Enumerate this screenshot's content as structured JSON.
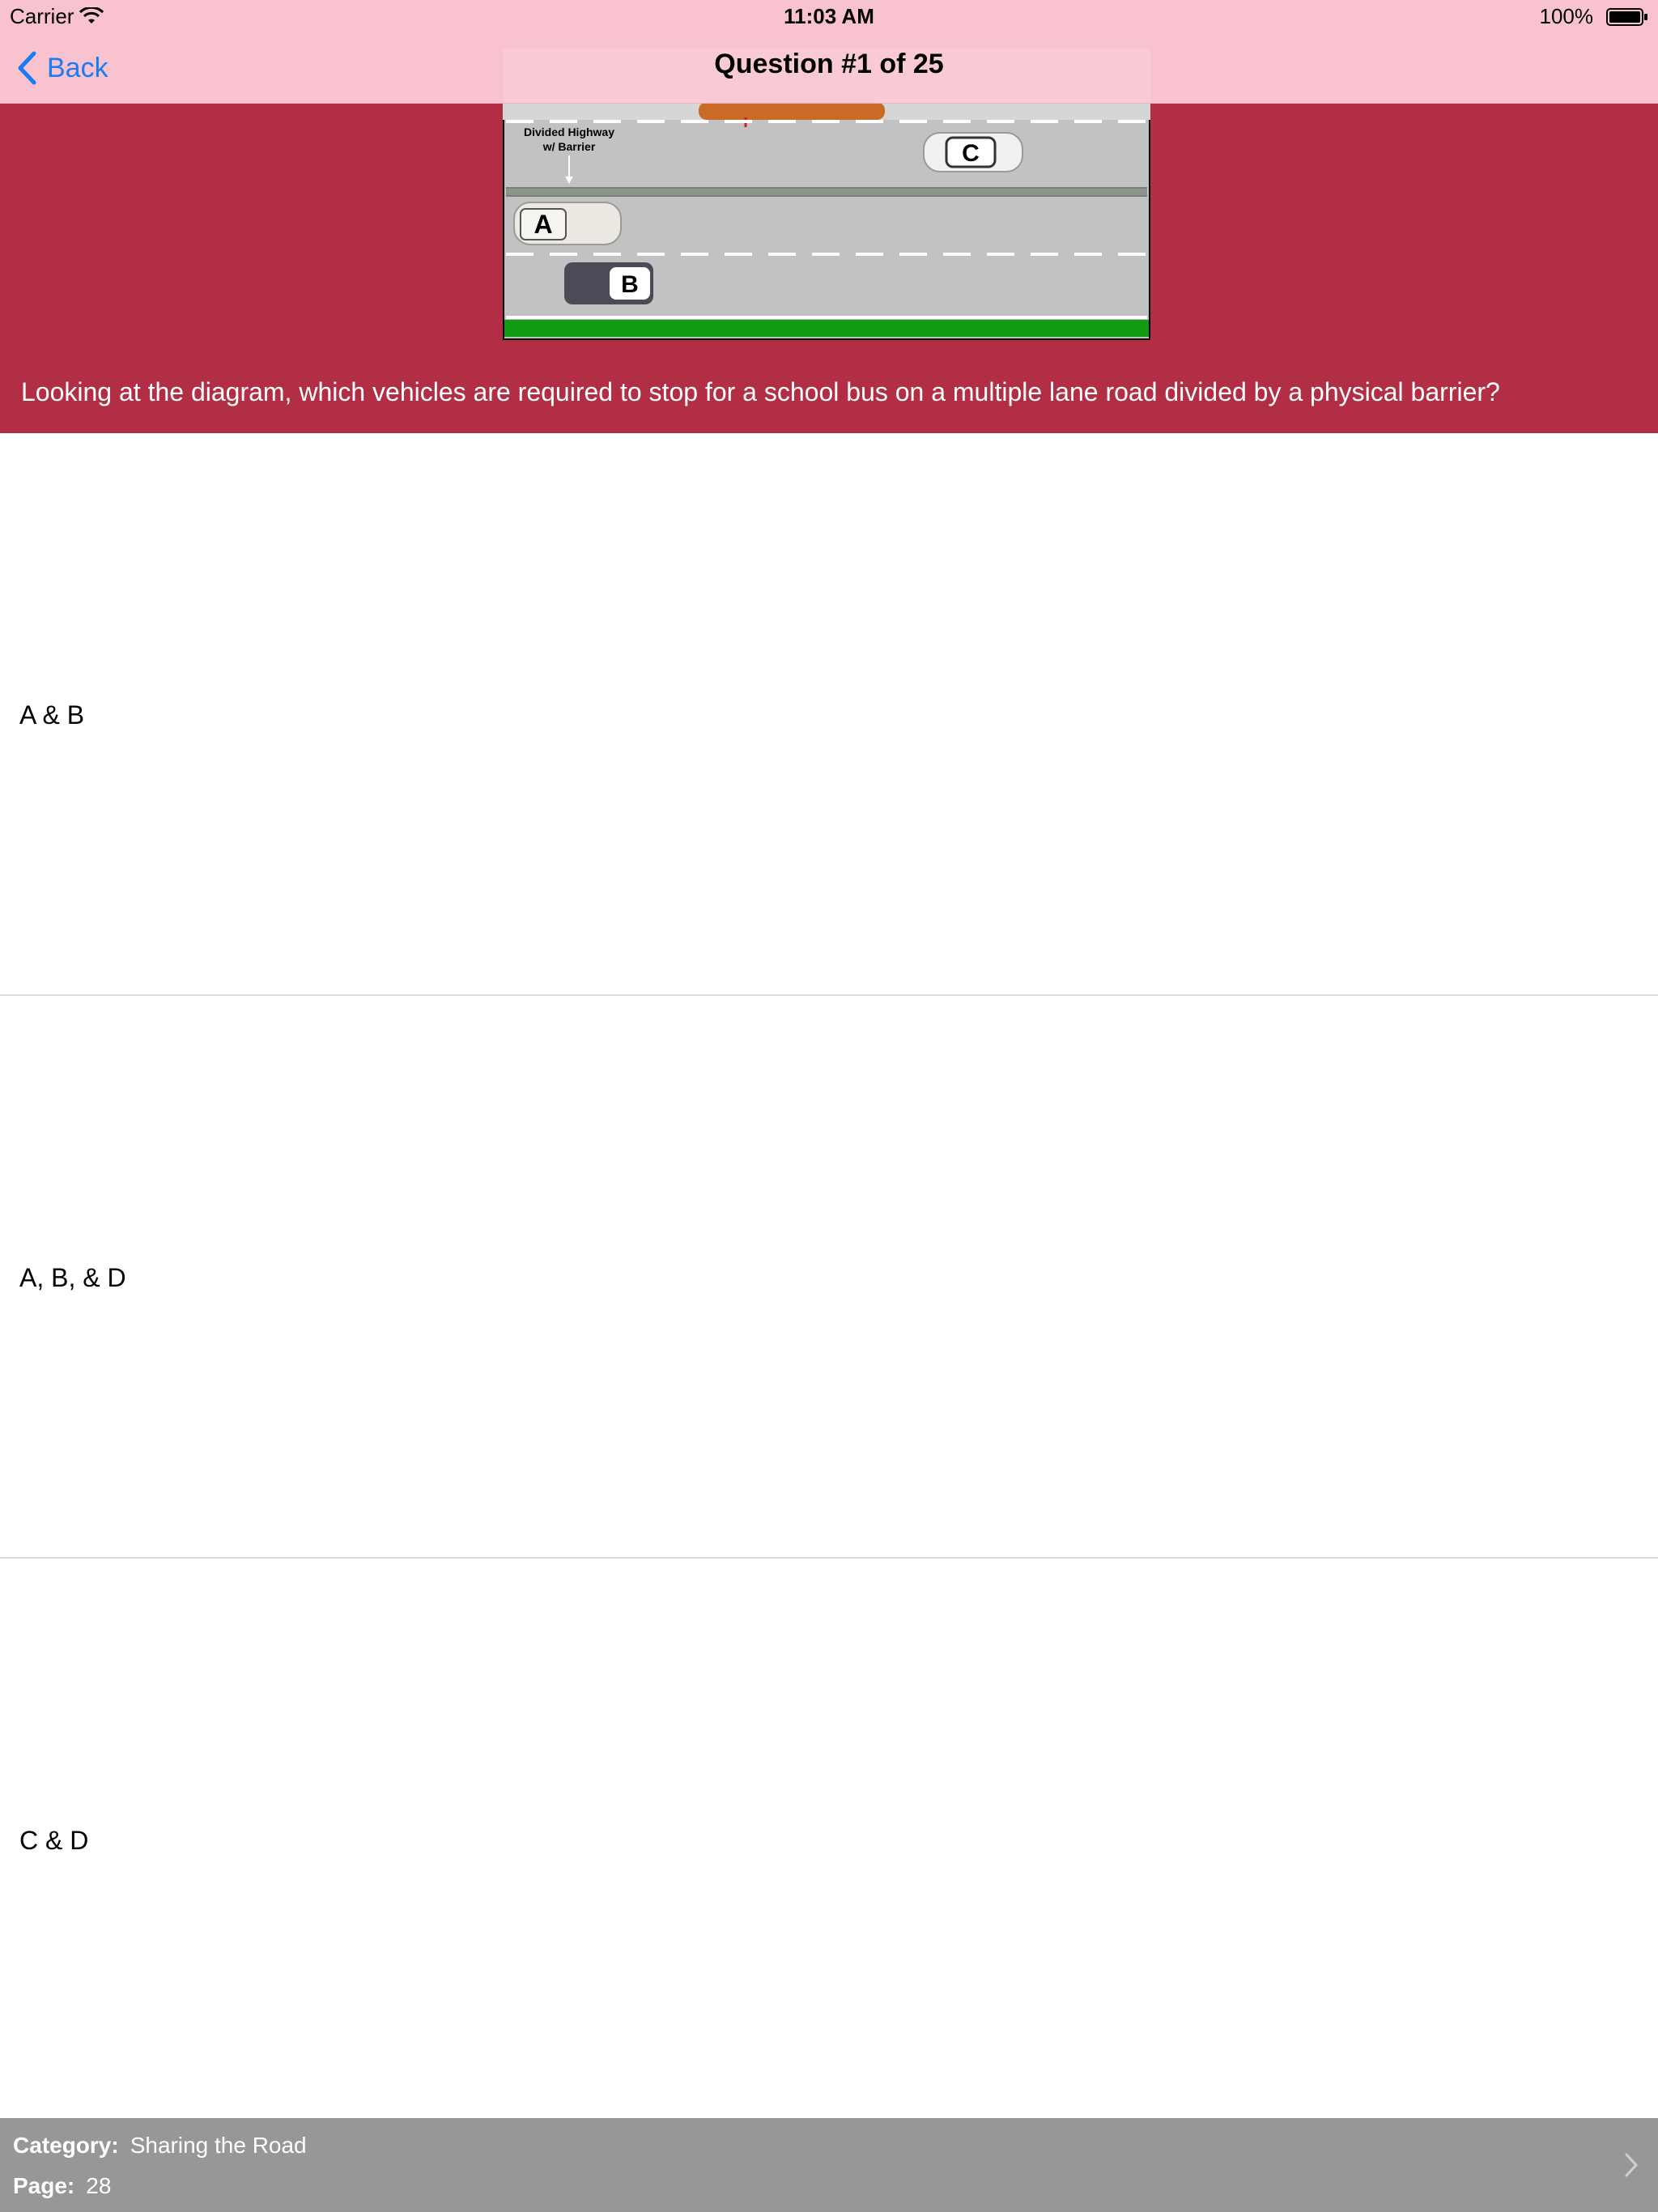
{
  "status_bar": {
    "carrier": "Carrier",
    "time": "11:03 AM",
    "battery": "100%"
  },
  "nav": {
    "back_label": "Back",
    "title": "Question #1 of 25",
    "tint_color": "#1a7cf5",
    "background_color": "#fac8d4"
  },
  "question": {
    "background_color": "#b12e45",
    "text": "Looking at the diagram, which vehicles are required to stop for a school bus on a multiple lane road divided by a physical barrier?",
    "diagram": {
      "barrier_label": "Divided Highway w/ Barrier",
      "vehicle_labels": [
        "A",
        "B",
        "C"
      ]
    }
  },
  "answers": [
    {
      "label": "A & B"
    },
    {
      "label": "A, B, & D"
    },
    {
      "label": "C & D"
    }
  ],
  "footer": {
    "category_key": "Category:",
    "category_value": "Sharing the Road",
    "page_key": "Page:",
    "page_value": "28",
    "background_color": "#979797"
  }
}
